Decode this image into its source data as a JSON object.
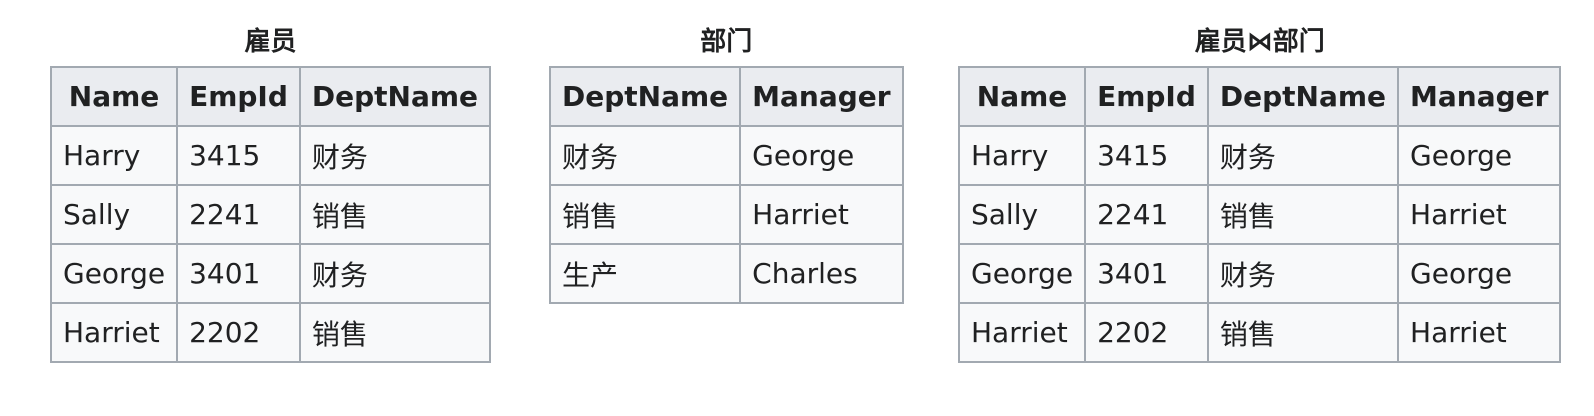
{
  "tables": [
    {
      "caption": "雇员",
      "headers": [
        "Name",
        "EmpId",
        "DeptName"
      ],
      "rows": [
        [
          "Harry",
          "3415",
          "财务"
        ],
        [
          "Sally",
          "2241",
          "销售"
        ],
        [
          "George",
          "3401",
          "财务"
        ],
        [
          "Harriet",
          "2202",
          "销售"
        ]
      ]
    },
    {
      "caption": "部门",
      "headers": [
        "DeptName",
        "Manager"
      ],
      "rows": [
        [
          "财务",
          "George"
        ],
        [
          "销售",
          "Harriet"
        ],
        [
          "生产",
          "Charles"
        ]
      ]
    },
    {
      "caption": "雇员⋈部门",
      "headers": [
        "Name",
        "EmpId",
        "DeptName",
        "Manager"
      ],
      "rows": [
        [
          "Harry",
          "3415",
          "财务",
          "George"
        ],
        [
          "Sally",
          "2241",
          "销售",
          "Harriet"
        ],
        [
          "George",
          "3401",
          "财务",
          "George"
        ],
        [
          "Harriet",
          "2202",
          "销售",
          "Harriet"
        ]
      ]
    }
  ]
}
